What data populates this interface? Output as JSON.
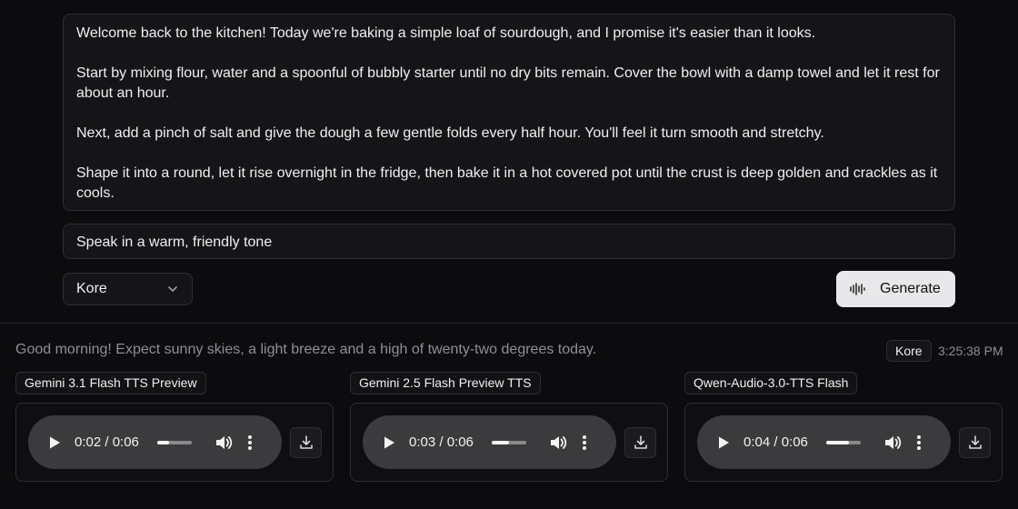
{
  "input": {
    "paragraphs": [
      "Welcome back to the kitchen! Today we're baking a simple loaf of sourdough, and I promise it's easier than it looks.",
      "Start by mixing flour, water and a spoonful of bubbly starter until no dry bits remain. Cover the bowl with a damp towel and let it rest for about an hour.",
      "Next, add a pinch of salt and give the dough a few gentle folds every half hour. You'll feel it turn smooth and stretchy.",
      "Shape it into a round, let it rise overnight in the fridge, then bake it in a hot covered pot until the crust is deep golden and crackles as it cools."
    ],
    "instructions": "Speak in a warm, friendly tone"
  },
  "controls": {
    "voice": "Kore",
    "generate_label": "Generate"
  },
  "result": {
    "text": "Good morning! Expect sunny skies, a light breeze and a high of twenty-two degrees today.",
    "voice": "Kore",
    "timestamp": "3:25:38 PM",
    "outputs": [
      {
        "model": "Gemini 3.1 Flash TTS Preview",
        "time": "0:02 / 0:06",
        "progress": 0.33
      },
      {
        "model": "Gemini 2.5 Flash Preview TTS",
        "time": "0:03 / 0:06",
        "progress": 0.5
      },
      {
        "model": "Qwen-Audio-3.0-TTS Flash",
        "time": "0:04 / 0:06",
        "progress": 0.67
      }
    ]
  },
  "icons": {
    "chevron": "chevron-down-icon",
    "waveform": "waveform-icon",
    "play": "play-icon",
    "volume": "volume-icon",
    "more": "more-vertical-icon",
    "download": "download-icon"
  }
}
